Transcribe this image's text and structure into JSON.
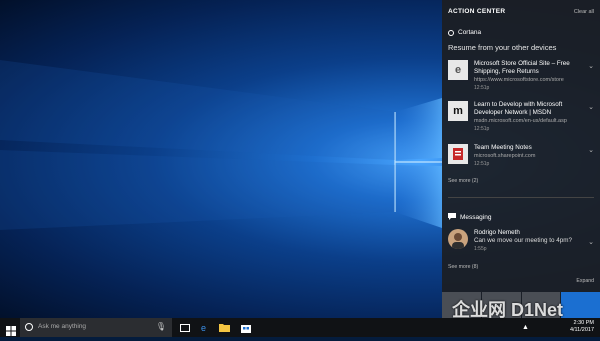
{
  "action_center": {
    "title": "ACTION CENTER",
    "clear_all": "Clear all",
    "cortana": {
      "header": "Cortana",
      "subheader": "Resume from your other devices",
      "items": [
        {
          "thumb": "e",
          "title": "Microsoft Store Official Site – Free Shipping, Free Returns",
          "url": "https://www.microsoftstore.com/store",
          "time": "12:51p",
          "icon": "edge-icon"
        },
        {
          "thumb": "m",
          "title": "Learn to Develop with Microsoft Developer Network | MSDN",
          "url": "msdn.microsoft.com/en-us/default.asp",
          "time": "12:51p",
          "icon": "msdn-icon"
        },
        {
          "thumb": "",
          "title": "Team Meeting Notes",
          "url": "microsoft.sharepoint.com",
          "time": "12:51p",
          "icon": "onenote-icon"
        }
      ],
      "see_more": "See more (2)"
    },
    "messaging": {
      "header": "Messaging",
      "sender": "Rodrigo Nemeth",
      "message": "Can we move our meeting to 4pm?",
      "time": "1:55p",
      "see_more": "See more (8)"
    },
    "expand": "Expand",
    "accent_color": "#1b6fd1"
  },
  "taskbar": {
    "search_placeholder": "Ask me anything",
    "time": "2:30 PM",
    "date": "4/11/2017"
  },
  "watermark": "企业网 D1Net"
}
